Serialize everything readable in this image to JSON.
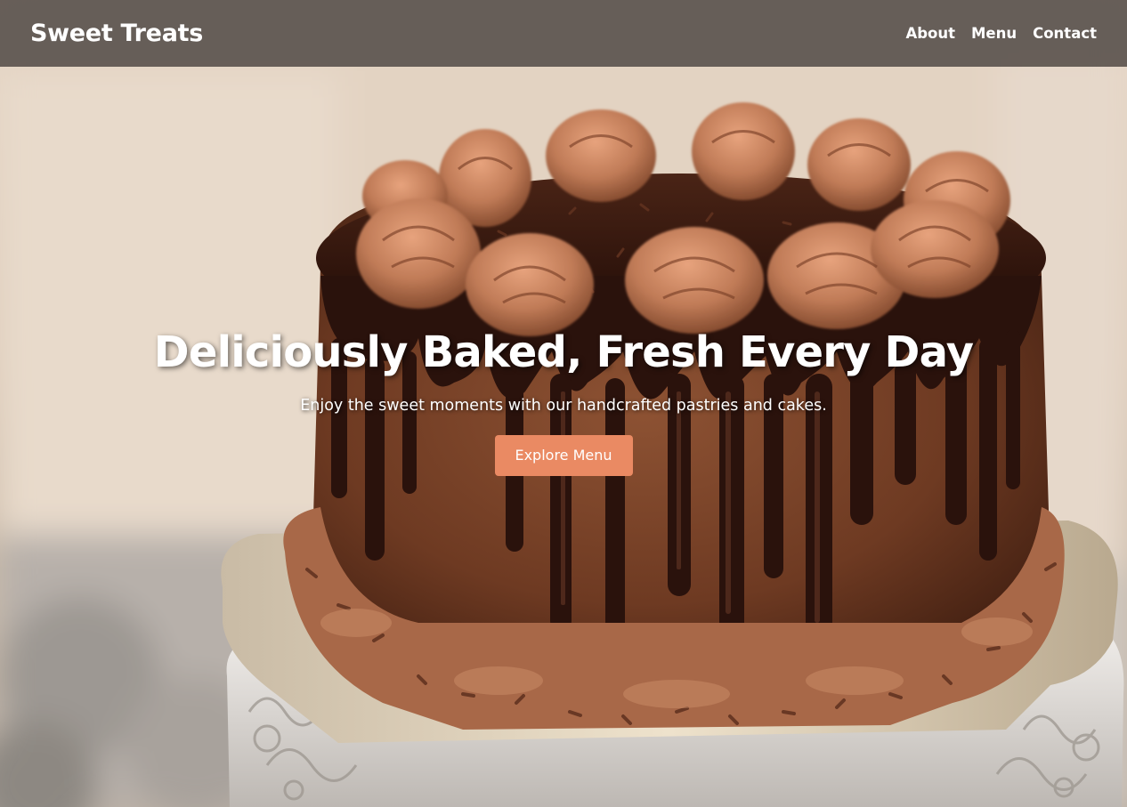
{
  "header": {
    "brand": "Sweet Treats",
    "nav": [
      {
        "label": "About"
      },
      {
        "label": "Menu"
      },
      {
        "label": "Contact"
      }
    ]
  },
  "hero": {
    "title": "Deliciously Baked, Fresh Every Day",
    "subtitle": "Enjoy the sweet moments with our handcrafted pastries and cakes.",
    "cta_label": "Explore Menu",
    "background_image": "chocolate-drip-cake-on-stand"
  },
  "colors": {
    "header_bg": "#524b46",
    "cta_bg": "#ea8a63",
    "text": "#ffffff",
    "frosting": "#b86f4c",
    "ganache": "#2a120c"
  }
}
